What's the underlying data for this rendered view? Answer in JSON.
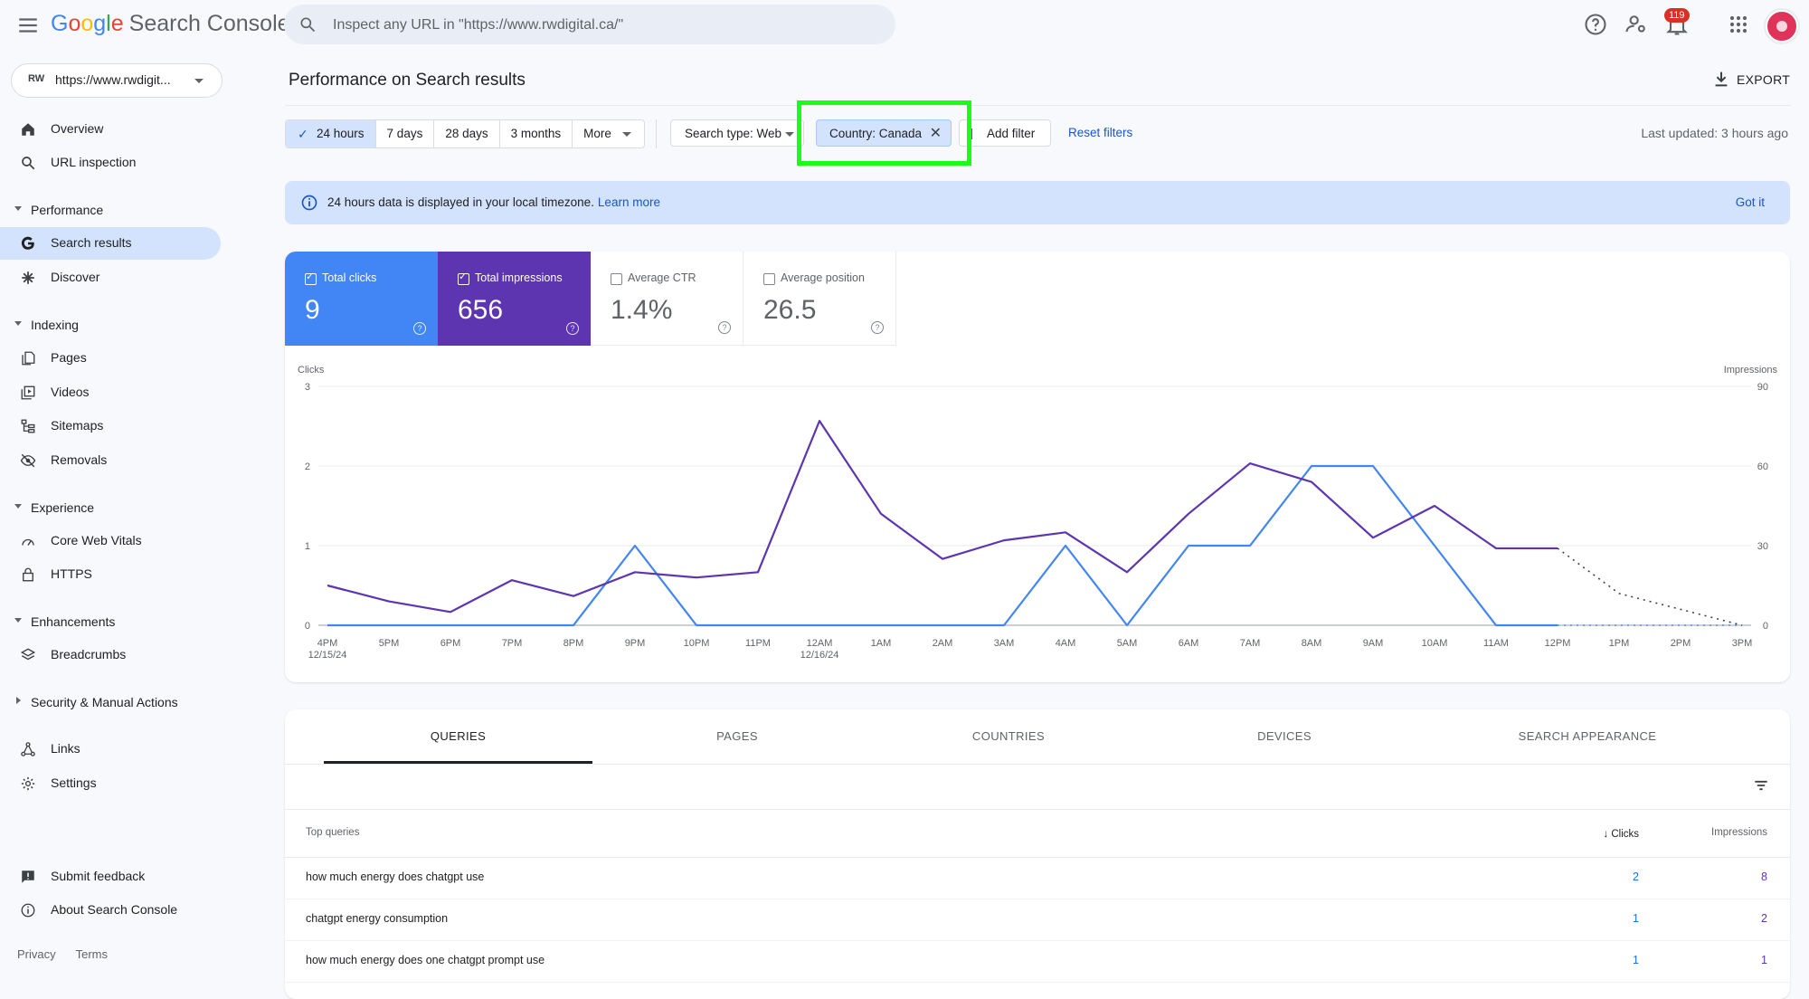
{
  "app": {
    "logo_letters": [
      "G",
      "o",
      "o",
      "g",
      "l",
      "e"
    ],
    "product": "Search Console",
    "search_placeholder": "Inspect any URL in \"https://www.rwdigital.ca/\"",
    "notification_count": "119",
    "property_badge": "RW",
    "property_url": "https://www.rwdigit..."
  },
  "sidebar": {
    "top_items": [
      {
        "label": "Overview",
        "icon": "home-icon"
      },
      {
        "label": "URL inspection",
        "icon": "search-icon"
      }
    ],
    "performance": {
      "label": "Performance",
      "items": [
        {
          "label": "Search results",
          "icon": "google-g-icon",
          "active": true
        },
        {
          "label": "Discover",
          "icon": "asterisk-icon"
        }
      ]
    },
    "indexing": {
      "label": "Indexing",
      "items": [
        {
          "label": "Pages",
          "icon": "pages-icon"
        },
        {
          "label": "Videos",
          "icon": "video-icon"
        },
        {
          "label": "Sitemaps",
          "icon": "sitemap-icon"
        },
        {
          "label": "Removals",
          "icon": "eye-off-icon"
        }
      ]
    },
    "experience": {
      "label": "Experience",
      "items": [
        {
          "label": "Core Web Vitals",
          "icon": "gauge-icon"
        },
        {
          "label": "HTTPS",
          "icon": "lock-icon"
        }
      ]
    },
    "enhancements": {
      "label": "Enhancements",
      "items": [
        {
          "label": "Breadcrumbs",
          "icon": "layers-icon"
        }
      ]
    },
    "security": {
      "label": "Security & Manual Actions"
    },
    "other_items": [
      {
        "label": "Links",
        "icon": "links-icon"
      },
      {
        "label": "Settings",
        "icon": "gear-icon"
      }
    ],
    "bottom_items": [
      {
        "label": "Submit feedback",
        "icon": "feedback-icon"
      },
      {
        "label": "About Search Console",
        "icon": "info-icon"
      }
    ],
    "footer": {
      "privacy": "Privacy",
      "terms": "Terms"
    }
  },
  "main": {
    "title": "Performance on Search results",
    "export_label": "EXPORT",
    "date_ranges": [
      "24 hours",
      "7 days",
      "28 days",
      "3 months"
    ],
    "date_more": "More",
    "selected_range": "24 hours",
    "search_type_chip": "Search type: Web",
    "country_chip": "Country: Canada",
    "add_filter": "Add filter",
    "reset_filters": "Reset filters",
    "last_updated": "Last updated: 3 hours ago",
    "banner_text": "24 hours data is displayed in your local timezone.",
    "banner_learn_more": "Learn more",
    "banner_got_it": "Got it"
  },
  "metrics": {
    "total_clicks": {
      "label": "Total clicks",
      "value": "9",
      "checked": true,
      "color": "#4285f4"
    },
    "total_impressions": {
      "label": "Total impressions",
      "value": "656",
      "checked": true,
      "color": "#5e35b1"
    },
    "average_ctr": {
      "label": "Average CTR",
      "value": "1.4%",
      "checked": false
    },
    "average_position": {
      "label": "Average position",
      "value": "26.5",
      "checked": false
    }
  },
  "chart_data": {
    "type": "line",
    "ylabel_left": "Clicks",
    "ylabel_right": "Impressions",
    "y_left_range": [
      0,
      3
    ],
    "y_left_ticks": [
      0,
      1,
      2,
      3
    ],
    "y_right_range": [
      0,
      90
    ],
    "y_right_ticks": [
      0,
      30,
      60,
      90
    ],
    "x_ticks": [
      "4 PM",
      "5 PM",
      "6 PM",
      "7 PM",
      "8 PM",
      "9 PM",
      "10 PM",
      "11 PM",
      "12 AM",
      "1 AM",
      "2 AM",
      "3 AM",
      "4 AM",
      "5 AM",
      "6 AM",
      "7 AM",
      "8 AM",
      "9 AM",
      "10 AM",
      "11 AM",
      "12 PM",
      "1 PM",
      "2 PM",
      "3 PM"
    ],
    "x_tick_sublabels": {
      "4 PM": "12/15/24",
      "12 AM": "12/16/24"
    },
    "grid": true,
    "series": [
      {
        "name": "Clicks",
        "axis": "left",
        "color": "#4285f4",
        "values": [
          0,
          0,
          0,
          0,
          0,
          1,
          0,
          0,
          0,
          0,
          0,
          0,
          1,
          0,
          1,
          1,
          2,
          2,
          1,
          0,
          0,
          null,
          null,
          null
        ],
        "projected_from": 20,
        "projected": [
          0,
          0,
          0,
          0
        ]
      },
      {
        "name": "Impressions",
        "axis": "right",
        "color": "#5e35b1",
        "values": [
          15,
          9,
          5,
          17,
          11,
          20,
          18,
          20,
          77,
          42,
          25,
          32,
          35,
          20,
          42,
          61,
          54,
          33,
          45,
          29,
          29,
          null,
          null,
          null
        ],
        "projected_from": 20,
        "projected": [
          29,
          12,
          6,
          0
        ]
      }
    ]
  },
  "table": {
    "tabs": [
      "QUERIES",
      "PAGES",
      "COUNTRIES",
      "DEVICES",
      "SEARCH APPEARANCE"
    ],
    "active_tab": "QUERIES",
    "headers": {
      "query": "Top queries",
      "clicks": "Clicks",
      "impressions": "Impressions"
    },
    "rows": [
      {
        "query": "how much energy does chatgpt use",
        "clicks": "2",
        "impressions": "8"
      },
      {
        "query": "chatgpt energy consumption",
        "clicks": "1",
        "impressions": "2"
      },
      {
        "query": "how much energy does one chatgpt prompt use",
        "clicks": "1",
        "impressions": "1"
      }
    ]
  }
}
